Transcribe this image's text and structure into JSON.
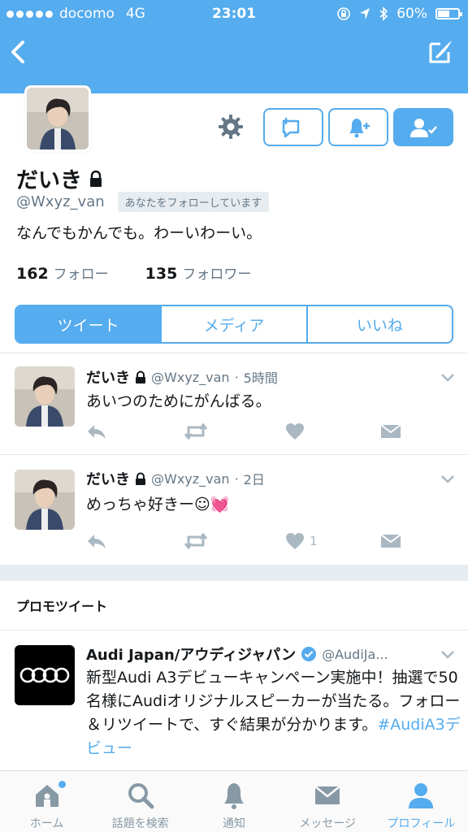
{
  "status_bar": {
    "carrier": "docomo",
    "network": "4G",
    "time": "23:01",
    "battery": "60%",
    "battery_level": 0.6
  },
  "profile": {
    "display_name": "だいき",
    "handle": "@Wxyz_van",
    "follows_you": "あなたをフォローしています",
    "bio": "なんでもかんでも。わーいわーい。",
    "following_count": "162",
    "following_label": "フォロー",
    "followers_count": "135",
    "followers_label": "フォロワー"
  },
  "profile_tabs": {
    "tweets": "ツイート",
    "media": "メディア",
    "likes": "いいね"
  },
  "tweets": [
    {
      "name": "だいき",
      "handle": "@Wxyz_van",
      "time": "5時間",
      "text": "あいつのためにがんばる。",
      "like_count": ""
    },
    {
      "name": "だいき",
      "handle": "@Wxyz_van",
      "time": "2日",
      "text": "めっちゃ好きー☺💓",
      "like_count": "1"
    }
  ],
  "promoted": {
    "section_title": "プロモツイート",
    "name": "Audi Japan/アウディジャパン",
    "handle": "@AudiJa...",
    "text": "新型Audi A3デビューキャンペーン実施中！抽選で50名様にAudiオリジナルスピーカーが当たる。フォロー＆リツイートで、すぐ結果が分かります。",
    "hashtag": "#AudiA3デビュー"
  },
  "tab_bar": {
    "home": "ホーム",
    "search": "話題を検索",
    "notifications": "通知",
    "messages": "メッセージ",
    "profile": "プロフィール"
  },
  "colors": {
    "accent": "#55acee",
    "muted": "#657786",
    "icon_gray": "#aab8c2"
  },
  "icons": [
    "back-icon",
    "compose-icon",
    "gear-icon",
    "list-add-icon",
    "bell-plus-icon",
    "following-user-icon",
    "lock-icon",
    "reply-icon",
    "retweet-icon",
    "heart-icon",
    "dm-icon",
    "chevron-down-icon",
    "verified-icon",
    "audi-rings-logo",
    "home-icon",
    "search-icon",
    "bell-icon",
    "envelope-icon",
    "user-icon"
  ]
}
